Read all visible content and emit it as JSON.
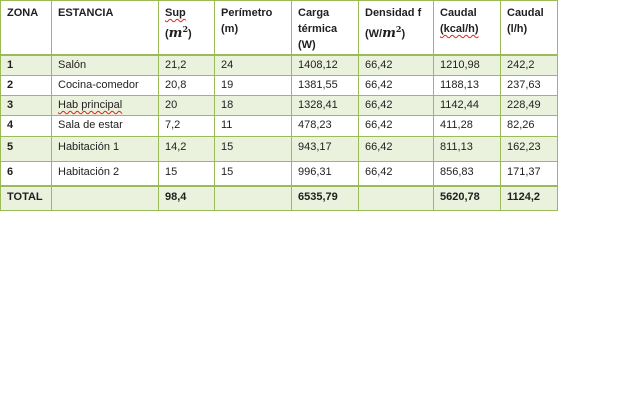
{
  "table": {
    "headers": {
      "zona": "ZONA",
      "estancia": "ESTANCIA",
      "sup": "Sup",
      "sup_unit_open": "(",
      "sup_unit_var": "m",
      "sup_unit_exp": "2",
      "sup_unit_close": ")",
      "perimetro": "Perímetro",
      "perimetro_unit": "(m)",
      "carga": "Carga",
      "carga_2": "térmica",
      "carga_unit": "(W)",
      "densidad": "Densidad f",
      "densidad_unit_open": "(W/",
      "densidad_unit_var": "m",
      "densidad_unit_exp": "2",
      "densidad_unit_close": ")",
      "caudal1": "Caudal",
      "caudal1_unit": "(kcal/h)",
      "caudal2": "Caudal",
      "caudal2_unit": "(l/h)"
    },
    "rows": [
      {
        "zona": "1",
        "estancia": "Salón",
        "sup": "21,2",
        "perimetro": "24",
        "carga": "1408,12",
        "densidad": "66,42",
        "caudal_kcal": "1210,98",
        "caudal_l": "242,2"
      },
      {
        "zona": "2",
        "estancia": "Cocina-comedor",
        "sup": "20,8",
        "perimetro": "19",
        "carga": "1381,55",
        "densidad": "66,42",
        "caudal_kcal": "1188,13",
        "caudal_l": "237,63"
      },
      {
        "zona": "3",
        "estancia": "Hab principal",
        "sup": "20",
        "perimetro": "18",
        "carga": "1328,41",
        "densidad": "66,42",
        "caudal_kcal": "1142,44",
        "caudal_l": "228,49"
      },
      {
        "zona": "4",
        "estancia": "Sala de estar",
        "sup": "7,2",
        "perimetro": "11",
        "carga": "478,23",
        "densidad": "66,42",
        "caudal_kcal": "411,28",
        "caudal_l": "82,26"
      },
      {
        "zona": "5",
        "estancia": "Habitación 1",
        "sup": "14,2",
        "perimetro": "15",
        "carga": "943,17",
        "densidad": "66,42",
        "caudal_kcal": "811,13",
        "caudal_l": "162,23"
      },
      {
        "zona": "6",
        "estancia": "Habitación 2",
        "sup": "15",
        "perimetro": "15",
        "carga": "996,31",
        "densidad": "66,42",
        "caudal_kcal": "856,83",
        "caudal_l": "171,37"
      }
    ],
    "total": {
      "label": "TOTAL",
      "sup": "98,4",
      "carga": "6535,79",
      "caudal_kcal": "5620,78",
      "caudal_l": "1124,2"
    },
    "colors": {
      "border": "#9bbb59",
      "shaded_row": "#eaf1dd",
      "spellcheck_underline": "#dd2222"
    }
  }
}
